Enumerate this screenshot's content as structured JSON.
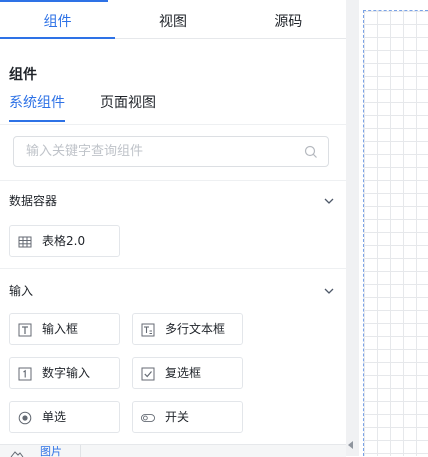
{
  "tabs": [
    {
      "label": "组件",
      "active": true
    },
    {
      "label": "视图",
      "active": false
    },
    {
      "label": "源码",
      "active": false
    }
  ],
  "section_title": "组件",
  "subtabs": [
    {
      "label": "系统组件",
      "active": true
    },
    {
      "label": "页面视图",
      "active": false
    }
  ],
  "search": {
    "placeholder": "输入关键字查询组件",
    "value": ""
  },
  "groups": [
    {
      "label": "数据容器",
      "expanded": true,
      "items": [
        {
          "label": "表格2.0",
          "icon": "table-icon"
        }
      ]
    },
    {
      "label": "输入",
      "expanded": true,
      "items": [
        {
          "label": "输入框",
          "icon": "text-input-icon"
        },
        {
          "label": "多行文本框",
          "icon": "textarea-icon"
        },
        {
          "label": "数字输入",
          "icon": "number-input-icon"
        },
        {
          "label": "复选框",
          "icon": "checkbox-icon"
        },
        {
          "label": "单选",
          "icon": "radio-icon"
        },
        {
          "label": "开关",
          "icon": "switch-icon"
        }
      ]
    }
  ],
  "footer": {
    "label": "图片",
    "icon": "image-icon"
  },
  "colors": {
    "accent": "#2e72e6",
    "border": "#e3e6ea",
    "text": "#1f2329",
    "placeholder": "#bfc3c9"
  }
}
